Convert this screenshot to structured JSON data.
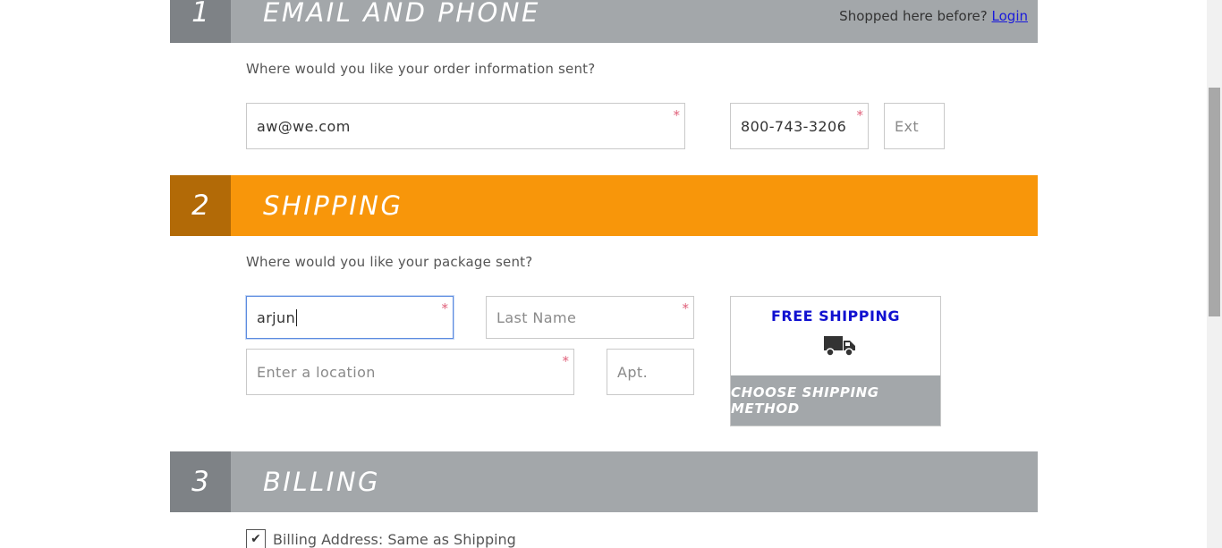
{
  "sections": [
    {
      "number": "1",
      "title": "EMAIL AND PHONE"
    },
    {
      "number": "2",
      "title": "SHIPPING"
    },
    {
      "number": "3",
      "title": "BILLING"
    }
  ],
  "login": {
    "prompt": "Shopped here before?",
    "link": "Login"
  },
  "email_section": {
    "prompt": "Where would you like your order information sent?",
    "email_value": "aw@we.com",
    "phone_value": "800-743-3206",
    "ext_placeholder": "Ext"
  },
  "shipping_section": {
    "prompt": "Where would you like your package sent?",
    "first_name_value": "arjun",
    "last_name_placeholder": "Last Name",
    "location_placeholder": "Enter a location",
    "apt_placeholder": "Apt.",
    "free_shipping": "FREE SHIPPING",
    "choose_method": "CHOOSE SHIPPING METHOD",
    "truck_icon": "truck-icon"
  },
  "billing_section": {
    "same_as_shipping_label": "Billing Address: Same as Shipping",
    "same_as_shipping_checked": true,
    "check_mark": "✔"
  },
  "required_mark": "*",
  "colors": {
    "active_section": "#f8960a",
    "inactive_section": "#a3a7aa",
    "link": "#1a1adc",
    "free_shipping": "#1010d0",
    "required": "#e0607a"
  }
}
